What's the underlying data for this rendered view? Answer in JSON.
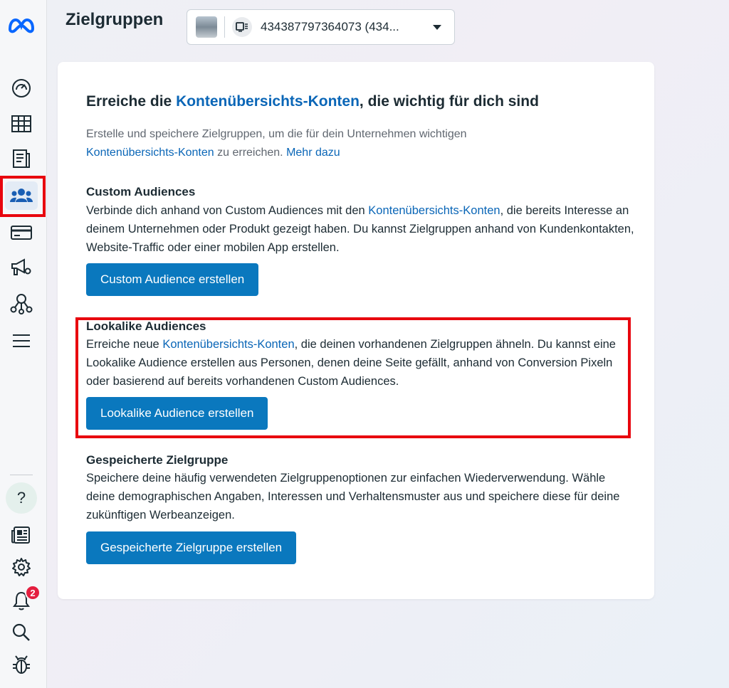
{
  "header": {
    "title": "Zielgruppen",
    "account_id": "434387797364073 (434..."
  },
  "sidebar": {
    "items": [
      {
        "name": "meta-logo-icon"
      },
      {
        "name": "dashboard-gauge-icon"
      },
      {
        "name": "table-icon"
      },
      {
        "name": "pages-icon"
      },
      {
        "name": "audiences-icon",
        "active": true
      },
      {
        "name": "billing-card-icon"
      },
      {
        "name": "ads-manager-megaphone-icon"
      },
      {
        "name": "network-graph-icon"
      },
      {
        "name": "menu-hamburger-icon"
      },
      {
        "name": "help-icon"
      },
      {
        "name": "news-icon"
      },
      {
        "name": "settings-gear-icon"
      },
      {
        "name": "notifications-bell-icon"
      },
      {
        "name": "search-icon"
      },
      {
        "name": "debug-bug-icon"
      }
    ],
    "help_label": "?",
    "notification_count": "2"
  },
  "card": {
    "heading_pre": "Erreiche die ",
    "heading_link": "Kontenübersichts-Konten",
    "heading_post": ", die wichtig für dich sind",
    "intro_line1": "Erstelle und speichere Zielgruppen, um die für dein Unternehmen wichtigen",
    "intro_link": "Kontenübersichts-Konten",
    "intro_mid": " zu erreichen. ",
    "intro_more": "Mehr dazu",
    "sections": [
      {
        "title": "Custom Audiences",
        "body_pre": "Verbinde dich anhand von Custom Audiences mit den ",
        "body_link": "Kontenübersichts-Konten",
        "body_post": ", die bereits Interesse an deinem Unternehmen oder Produkt gezeigt haben. Du kannst Zielgruppen anhand von Kundenkontakten, Website-Traffic oder einer mobilen App erstellen.",
        "button": "Custom Audience erstellen"
      },
      {
        "title": "Lookalike Audiences",
        "body_pre": "Erreiche neue ",
        "body_link": "Kontenübersichts-Konten",
        "body_post": ", die deinen vorhandenen Zielgruppen ähneln. Du kannst eine Lookalike Audience erstellen aus Personen, denen deine Seite gefällt, anhand von Conversion Pixeln oder basierend auf bereits vorhandenen Custom Audiences.",
        "button": "Lookalike Audience erstellen"
      },
      {
        "title": "Gespeicherte Zielgruppe",
        "body": "Speichere deine häufig verwendeten Zielgruppenoptionen zur einfachen Wiederverwendung. Wähle deine demographischen Angaben, Interessen und Verhaltensmuster aus und speichere diese für deine zukünftigen Werbeanzeigen.",
        "button": "Gespeicherte Zielgruppe erstellen"
      }
    ]
  },
  "colors": {
    "accent": "#0a78be",
    "link": "#0a66b7",
    "highlight": "#e8050e",
    "badge": "#e41e3f"
  }
}
